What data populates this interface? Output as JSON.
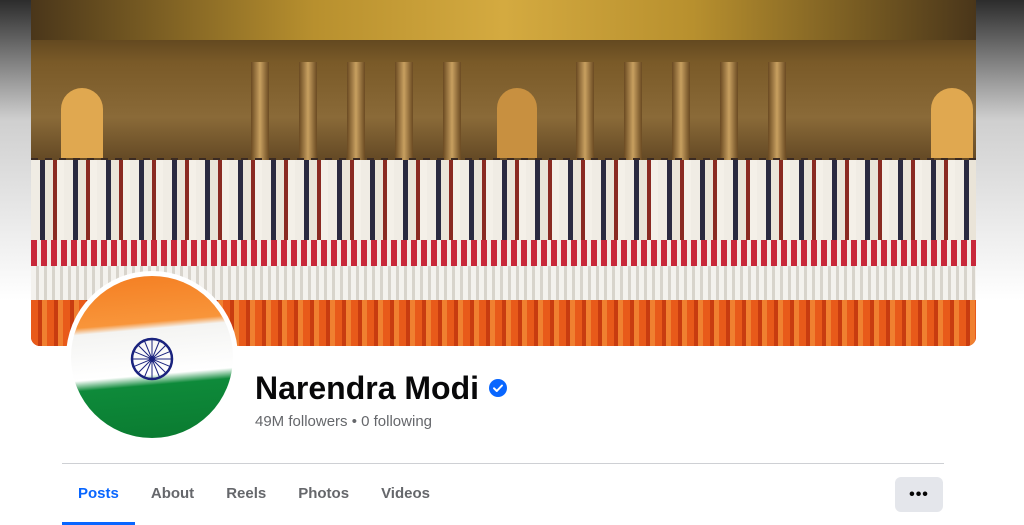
{
  "profile": {
    "name": "Narendra Modi",
    "verified": true,
    "followers_text": "49M followers • 0 following"
  },
  "tabs": [
    {
      "label": "Posts",
      "active": true
    },
    {
      "label": "About",
      "active": false
    },
    {
      "label": "Reels",
      "active": false
    },
    {
      "label": "Photos",
      "active": false
    },
    {
      "label": "Videos",
      "active": false
    }
  ],
  "more_button": {
    "label": "•••",
    "icon": "more-horizontal-icon"
  },
  "colors": {
    "accent": "#0866ff",
    "text_primary": "#080809",
    "text_secondary": "#65676b",
    "button_bg": "#e4e6eb",
    "verified_badge": "#0866ff"
  },
  "icons": {
    "verified": "verified-badge-icon",
    "avatar": "indian-flag-avatar"
  }
}
